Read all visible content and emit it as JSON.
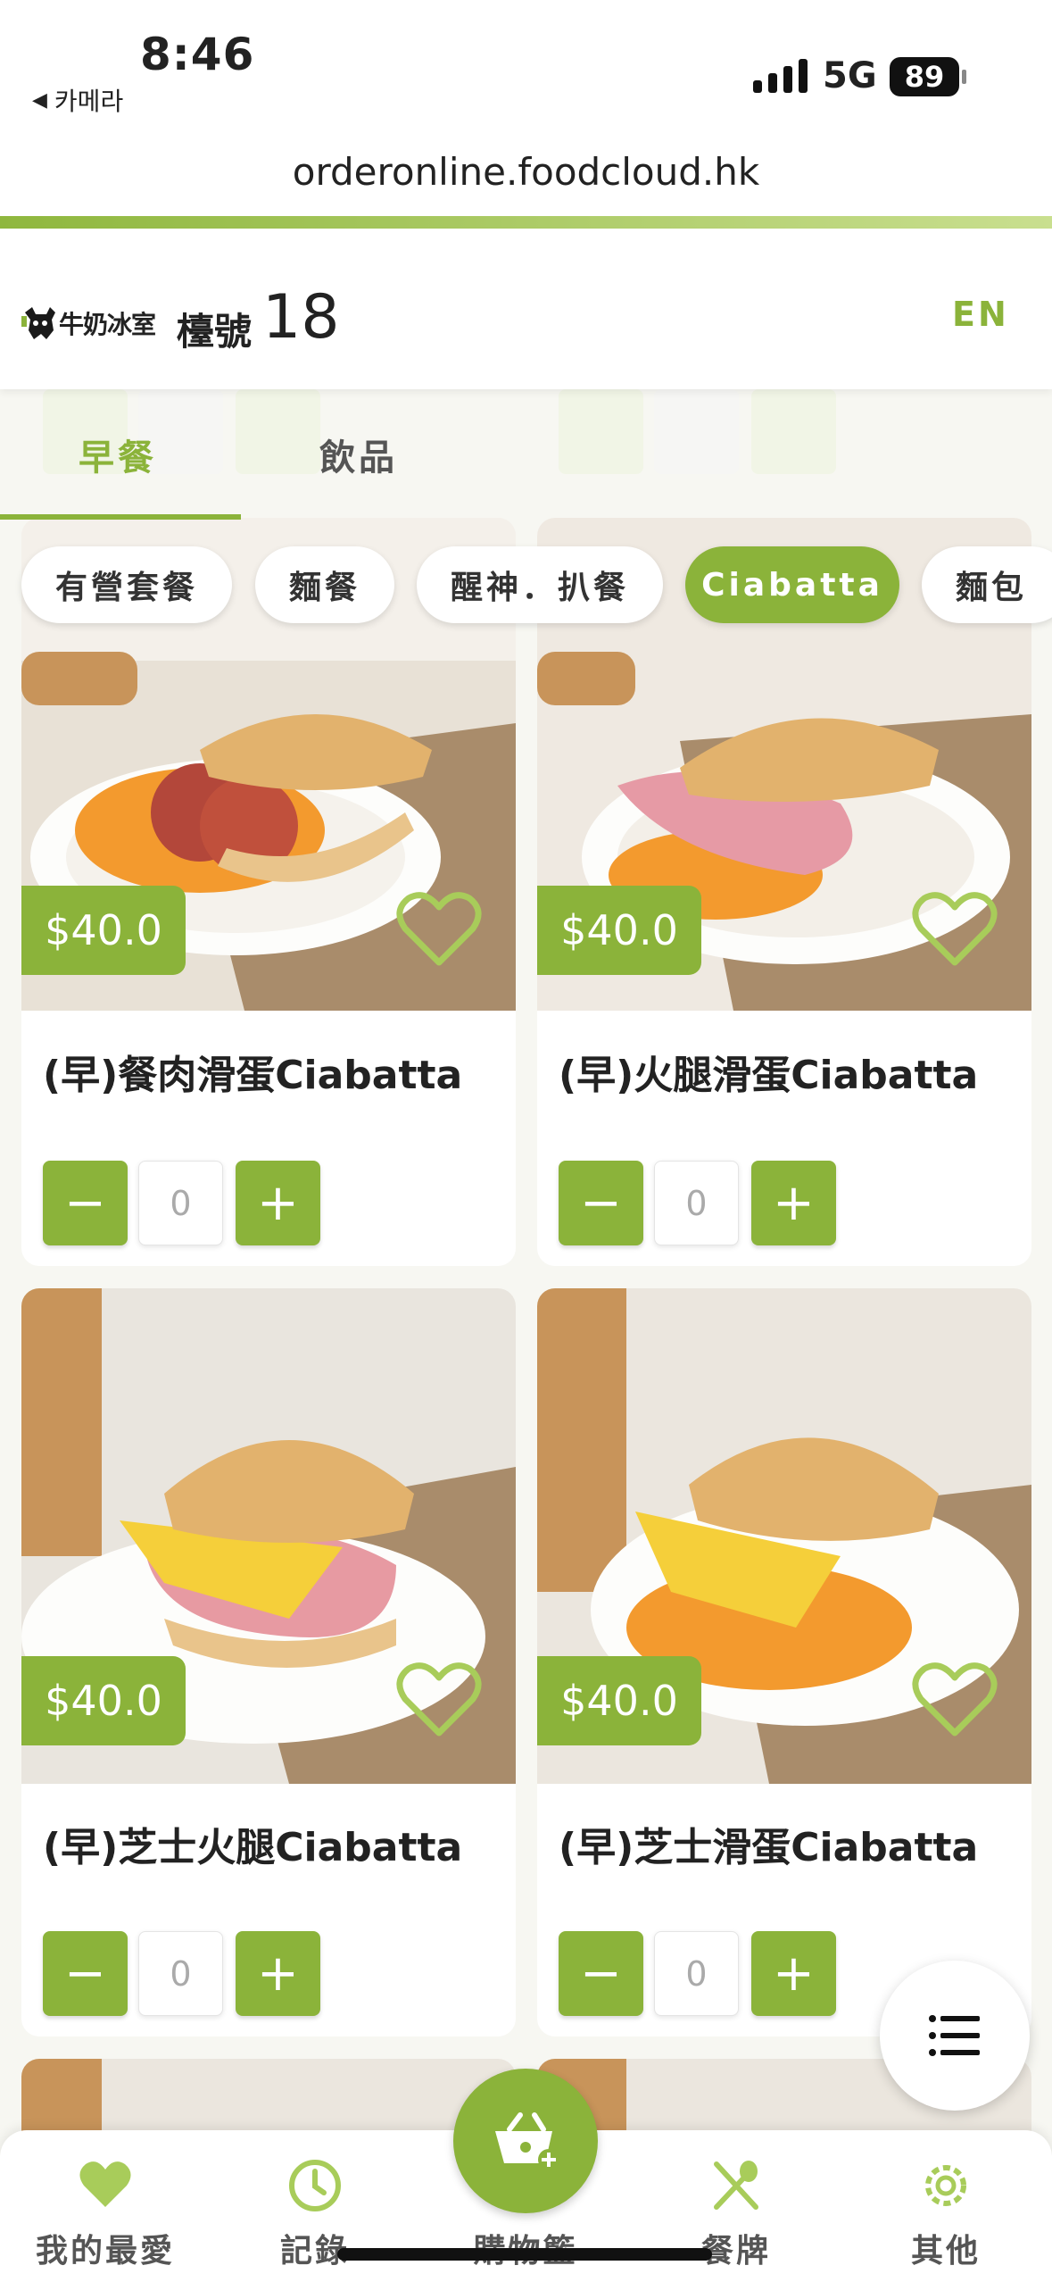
{
  "status_bar": {
    "time": "8:46",
    "back_app": "카메라",
    "network": "5G",
    "battery": "89"
  },
  "browser": {
    "url": "orderonline.foodcloud.hk"
  },
  "header": {
    "logo_text": "牛奶冰室",
    "table_label": "檯號",
    "table_number": "18",
    "language_toggle": "EN"
  },
  "tabs": [
    {
      "label": "早餐",
      "active": true
    },
    {
      "label": "飲品",
      "active": false
    }
  ],
  "categories": [
    {
      "label": "有營套餐",
      "active": false
    },
    {
      "label": "麵餐",
      "active": false
    },
    {
      "label": "醒神．扒餐",
      "active": false
    },
    {
      "label": "Ciabatta",
      "active": true
    },
    {
      "label": "麵包",
      "active": false
    }
  ],
  "products": [
    {
      "name": "(早)餐肉滑蛋Ciabatta",
      "price": "$40.0",
      "quantity": "0",
      "favorite": false
    },
    {
      "name": "(早)火腿滑蛋Ciabatta",
      "price": "$40.0",
      "quantity": "0",
      "favorite": false
    },
    {
      "name": "(早)芝士火腿Ciabatta",
      "price": "$40.0",
      "quantity": "0",
      "favorite": false
    },
    {
      "name": "(早)芝士滑蛋Ciabatta",
      "price": "$40.0",
      "quantity": "0",
      "favorite": false
    }
  ],
  "qty_controls": {
    "minus": "−",
    "plus": "+"
  },
  "bottom_nav": [
    {
      "label": "我的最愛",
      "icon": "heart-icon"
    },
    {
      "label": "記錄",
      "icon": "clock-icon"
    },
    {
      "label": "購物籃",
      "icon": "basket-icon"
    },
    {
      "label": "餐牌",
      "icon": "utensils-icon"
    },
    {
      "label": "其他",
      "icon": "gear-icon"
    }
  ],
  "colors": {
    "accent": "#8bb33a",
    "background": "#f7f7f2"
  }
}
